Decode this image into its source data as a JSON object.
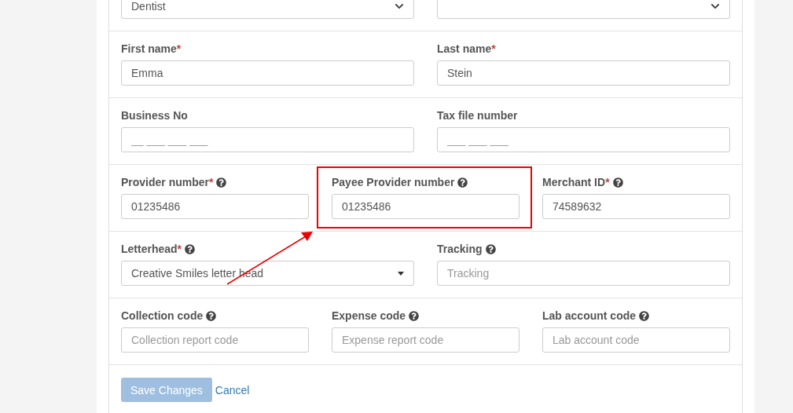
{
  "form": {
    "rows": [
      {
        "fields": [
          {
            "kind": "select",
            "value": "Dentist"
          },
          {
            "kind": "select"
          }
        ]
      },
      {
        "fields": [
          {
            "kind": "input",
            "label": "First name",
            "marker": "*",
            "value": "Emma"
          },
          {
            "kind": "input",
            "label": "Last name",
            "marker": "*",
            "value": "Stein"
          }
        ]
      },
      {
        "fields": [
          {
            "kind": "input",
            "label": "Business No",
            "placeholder": "__ ___ ___ ___"
          },
          {
            "kind": "input",
            "label": "Tax file number",
            "placeholder": "___ ___ ___"
          }
        ]
      },
      {
        "fields": [
          {
            "kind": "input",
            "label": "Provider number",
            "marker": "*",
            "help": true,
            "value": "01235486"
          },
          {
            "kind": "input",
            "label": "Payee Provider number",
            "help": true,
            "value": "01235486",
            "highlighted": true
          },
          {
            "kind": "input",
            "label": "Merchant ID",
            "marker": "*",
            "help": true,
            "value": "74589632"
          }
        ]
      },
      {
        "fields": [
          {
            "kind": "dropdown",
            "label": "Letterhead",
            "marker": "*",
            "help": true,
            "value": "Creative Smiles letter head"
          },
          {
            "kind": "input",
            "label": "Tracking",
            "help": true,
            "placeholder": "Tracking"
          }
        ]
      },
      {
        "fields": [
          {
            "kind": "input",
            "label": "Collection code",
            "help": true,
            "placeholder": "Collection report code"
          },
          {
            "kind": "input",
            "label": "Expense code",
            "help": true,
            "placeholder": "Expense report code"
          },
          {
            "kind": "input",
            "label": "Lab account code",
            "help": true,
            "placeholder": "Lab account code"
          }
        ]
      }
    ],
    "actions": {
      "save": {
        "label": "Save Changes",
        "disabled": true
      },
      "cancel": {
        "label": "Cancel"
      }
    }
  }
}
